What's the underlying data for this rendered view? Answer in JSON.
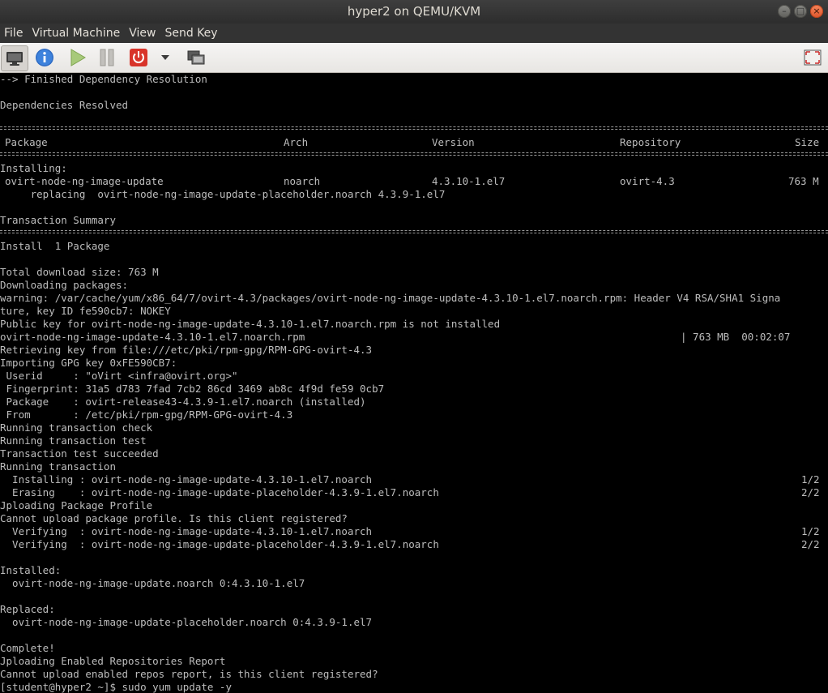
{
  "window": {
    "title": "hyper2 on QEMU/KVM"
  },
  "menu": [
    "File",
    "Virtual Machine",
    "View",
    "Send Key"
  ],
  "toolbar": {
    "icons": [
      "monitor-icon",
      "info-icon",
      "play-icon",
      "pause-icon",
      "power-icon",
      "chevron-down-icon",
      "snapshot-icon",
      "fullscreen-icon"
    ]
  },
  "colors": {
    "terminal_bg": "#000000",
    "terminal_fg": "#bdbdbd",
    "titlebar": "#2d2d2d",
    "close": "#e0552b"
  },
  "console": {
    "lines": [
      "--> Finished Dependency Resolution",
      "",
      "Dependencies Resolved",
      "",
      "",
      "",
      "",
      "",
      "Installing:",
      "",
      "     replacing  ovirt-node-ng-image-update-placeholder.noarch 4.3.9-1.el7",
      "",
      "Transaction Summary",
      "",
      "Install  1 Package",
      "",
      "Total download size: 763 M",
      "Downloading packages:",
      "warning: /var/cache/yum/x86_64/7/ovirt-4.3/packages/ovirt-node-ng-image-update-4.3.10-1.el7.noarch.rpm: Header V4 RSA/SHA1 Signa",
      "ture, key ID fe590cb7: NOKEY",
      "Public key for ovirt-node-ng-image-update-4.3.10-1.el7.noarch.rpm is not installed",
      "",
      "Retrieving key from file:///etc/pki/rpm-gpg/RPM-GPG-ovirt-4.3",
      "Importing GPG key 0xFE590CB7:",
      " Userid     : \"oVirt <infra@ovirt.org>\"",
      " Fingerprint: 31a5 d783 7fad 7cb2 86cd 3469 ab8c 4f9d fe59 0cb7",
      " Package    : ovirt-release43-4.3.9-1.el7.noarch (installed)",
      " From       : /etc/pki/rpm-gpg/RPM-GPG-ovirt-4.3",
      "Running transaction check",
      "Running transaction test",
      "Transaction test succeeded",
      "Running transaction",
      "",
      "",
      "Jploading Package Profile",
      "Cannot upload package profile. Is this client registered?",
      "",
      "",
      "",
      "Installed:",
      "  ovirt-node-ng-image-update.noarch 0:4.3.10-1.el7",
      "",
      "Replaced:",
      "  ovirt-node-ng-image-update-placeholder.noarch 0:4.3.9-1.el7",
      "",
      "Complete!",
      "Jploading Enabled Repositories Report",
      "Cannot upload enabled repos report, is this client registered?",
      "[student@hyper2 ~]$ sudo yum update -y"
    ],
    "table_header": [
      "Package",
      "Arch",
      "Version",
      "Repository",
      "Size"
    ],
    "table_row": [
      "ovirt-node-ng-image-update",
      "noarch",
      "4.3.10-1.el7",
      "ovirt-4.3",
      "763 M"
    ],
    "download": {
      "file": "ovirt-node-ng-image-update-4.3.10-1.el7.noarch.rpm",
      "stats": "| 763 MB  00:02:07"
    },
    "steps": [
      {
        "action": "  Installing : ovirt-node-ng-image-update-4.3.10-1.el7.noarch",
        "count": "1/2"
      },
      {
        "action": "  Erasing    : ovirt-node-ng-image-update-placeholder-4.3.9-1.el7.noarch",
        "count": "2/2"
      },
      {
        "action": "  Verifying  : ovirt-node-ng-image-update-4.3.10-1.el7.noarch",
        "count": "1/2"
      },
      {
        "action": "  Verifying  : ovirt-node-ng-image-update-placeholder-4.3.9-1.el7.noarch",
        "count": "2/2"
      }
    ]
  }
}
